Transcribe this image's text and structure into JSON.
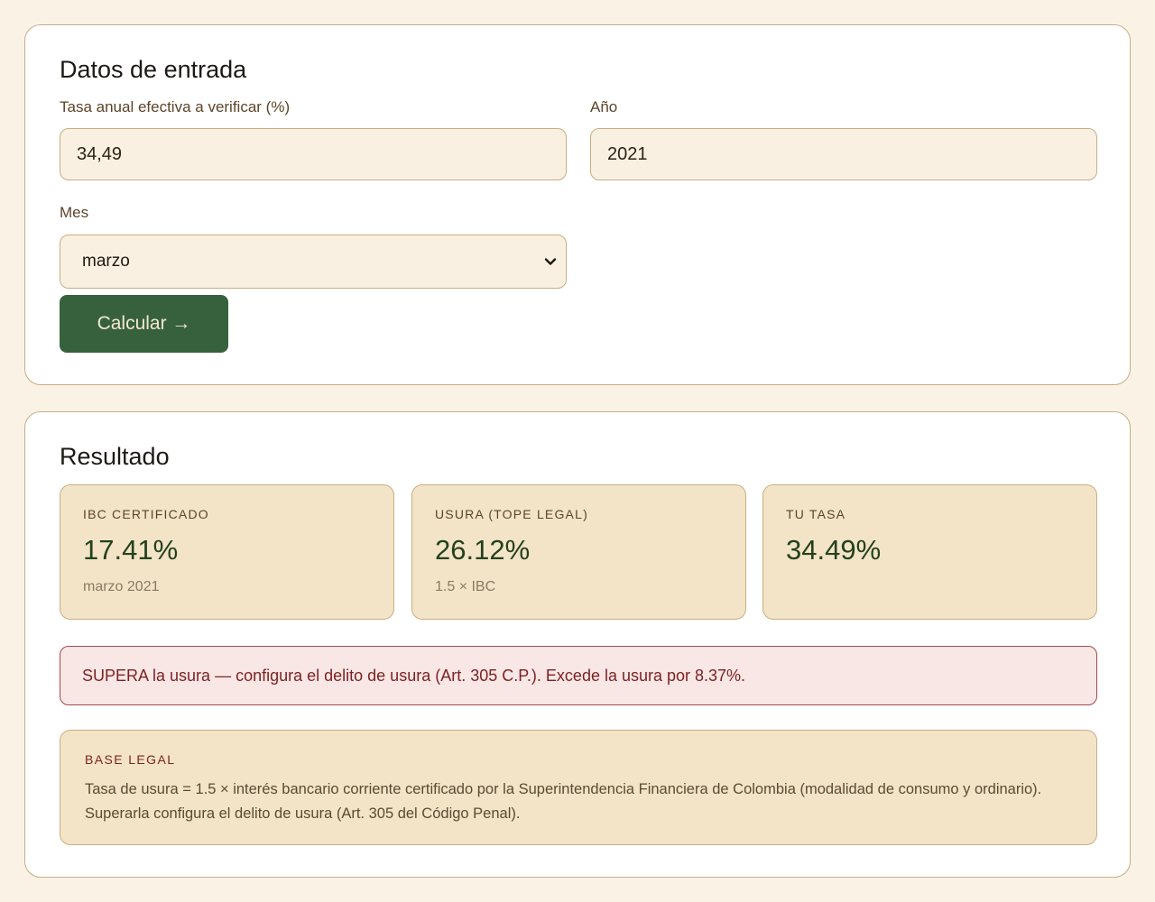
{
  "input_card": {
    "title": "Datos de entrada",
    "rate_label": "Tasa anual efectiva a verificar (%)",
    "rate_value": "34,49",
    "year_label": "Año",
    "year_value": "2021",
    "month_label": "Mes",
    "month_value": "marzo",
    "calculate_label": "Calcular →"
  },
  "result_card": {
    "title": "Resultado",
    "stats": [
      {
        "label": "IBC CERTIFICADO",
        "value": "17.41%",
        "sub": "marzo 2021"
      },
      {
        "label": "USURA (TOPE LEGAL)",
        "value": "26.12%",
        "sub": "1.5 × IBC"
      },
      {
        "label": "TU TASA",
        "value": "34.49%",
        "sub": ""
      }
    ],
    "alert": "SUPERA la usura — configura el delito de usura (Art. 305 C.P.). Excede la usura por 8.37%.",
    "legal": {
      "title": "BASE LEGAL",
      "text": "Tasa de usura = 1.5 × interés bancario corriente certificado por la Superintendencia Financiera de Colombia (modalidad de consumo y ordinario). Superarla configura el delito de usura (Art. 305 del Código Penal)."
    }
  },
  "colors": {
    "page_bg": "#faf2e5",
    "primary_button": "#37613d",
    "stat_bg": "#f3e4c7",
    "alert_bg": "#f9e7e6",
    "alert_text": "#7d2222"
  },
  "icons": {
    "select_arrow": "chevron-down-icon"
  }
}
